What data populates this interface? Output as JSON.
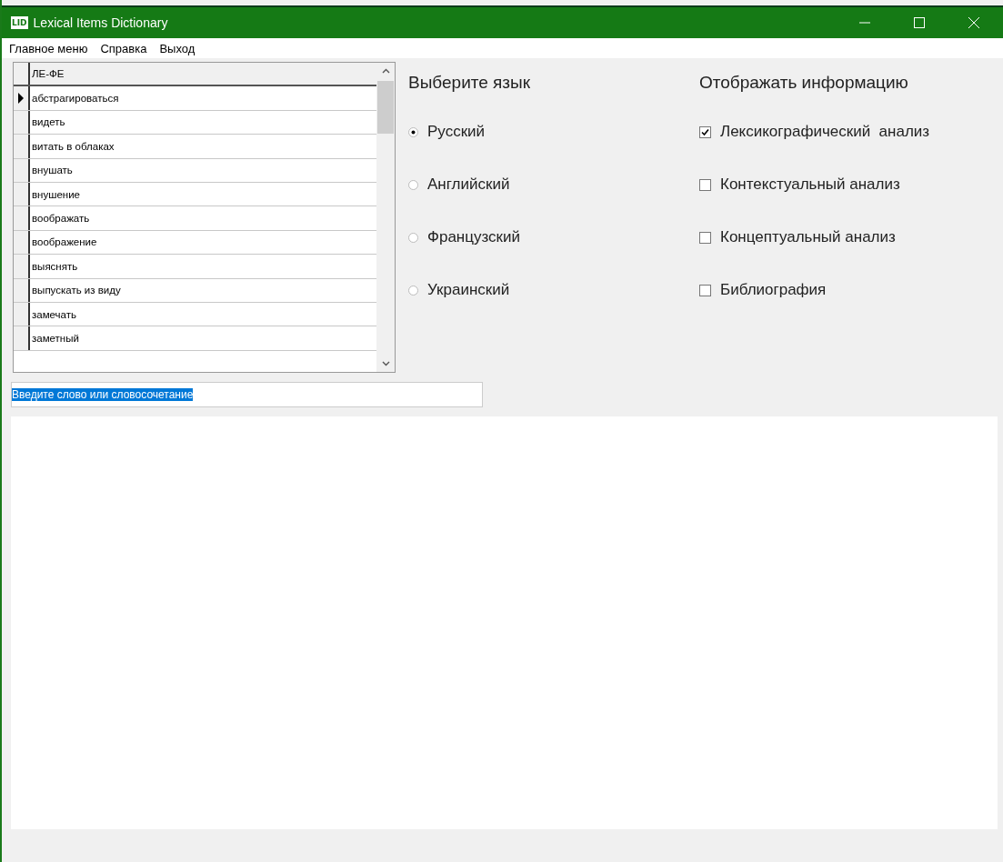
{
  "window": {
    "title": "Lexical Items Dictionary",
    "app_icon": "LID"
  },
  "menu": [
    "Главное меню",
    "Справка",
    "Выход"
  ],
  "grid": {
    "column": "ЛЕ-ФЕ",
    "rows": [
      {
        "text": "абстрагироваться",
        "selected": true
      },
      {
        "text": "видеть",
        "selected": false
      },
      {
        "text": "витать в облаках",
        "selected": false
      },
      {
        "text": "внушать",
        "selected": false
      },
      {
        "text": "внушение",
        "selected": false
      },
      {
        "text": "воображать",
        "selected": false
      },
      {
        "text": "воображение",
        "selected": false
      },
      {
        "text": "выяснять",
        "selected": false
      },
      {
        "text": "выпускать из виду",
        "selected": false
      },
      {
        "text": "замечать",
        "selected": false
      },
      {
        "text": "заметный",
        "selected": false
      }
    ]
  },
  "language": {
    "title": "Выберите язык",
    "options": [
      {
        "label": "Русский",
        "selected": true
      },
      {
        "label": "Английский",
        "selected": false
      },
      {
        "label": "Французский",
        "selected": false
      },
      {
        "label": "Украинский",
        "selected": false
      }
    ]
  },
  "display": {
    "title": "Отображать информацию",
    "options": [
      {
        "label": "Лексикографический  анализ",
        "checked": true
      },
      {
        "label": "Контекстуальный анализ",
        "checked": false
      },
      {
        "label": "Концептуальный анализ",
        "checked": false
      },
      {
        "label": "Библиография",
        "checked": false
      }
    ]
  },
  "search": {
    "value": "Введите слово или словосочетание",
    "text_selected": true
  }
}
